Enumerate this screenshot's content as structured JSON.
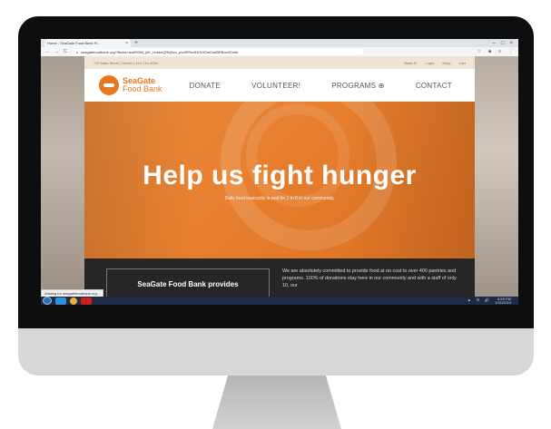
{
  "browser": {
    "tab_title": "Home - SeaGate Food Bank Fl...",
    "tab_close": "×",
    "new_tab": "+",
    "window_controls": [
      "–",
      "□",
      "×"
    ],
    "nav_buttons": [
      "←",
      "→",
      "C"
    ],
    "url": "seagatefoodbank.org/?fbclid=IwAR0Wj_j6K_hnkbnQRhj5cu_pvuRPkv4DHVtOmDx6BRBnx0Smib",
    "lock_icon": "lock-icon",
    "toolbar_icons": [
      "☆",
      "■",
      "≡",
      "⋮"
    ]
  },
  "site": {
    "topbar_text": "720 Main Street | Destin | 414-744-4094",
    "topbar_links": [
      "Make It!",
      "Login",
      "Shop",
      "Cart"
    ],
    "logo_line1": "SeaGate",
    "logo_line2": "Food Bank",
    "nav": {
      "donate": "DONATE",
      "volunteer": "VOLUNTEER!",
      "programs": "PROGRAMS ⊕",
      "contact": "CONTACT"
    },
    "hero_title": "Help us fight hunger",
    "hero_subtitle": "Daily food insecurity is real for 1 in 6 in our community.",
    "provides_label": "SeaGate Food Bank provides",
    "info_text": "We are absolutely committed to provide food at no cost to over 400 pantries and programs. 100% of donations stay here in our community and with a staff of only 10, our"
  },
  "status_tip": "Waiting for seagatefoodbank.org...",
  "taskbar": {
    "tray_icons": [
      "▲",
      "⊡",
      "🔊"
    ],
    "clock_time": "8:55 PM",
    "clock_date": "1/31/2019"
  },
  "colors": {
    "brand_orange": "#e87722",
    "dark_band": "#262626",
    "taskbar": "#1d2b44"
  }
}
